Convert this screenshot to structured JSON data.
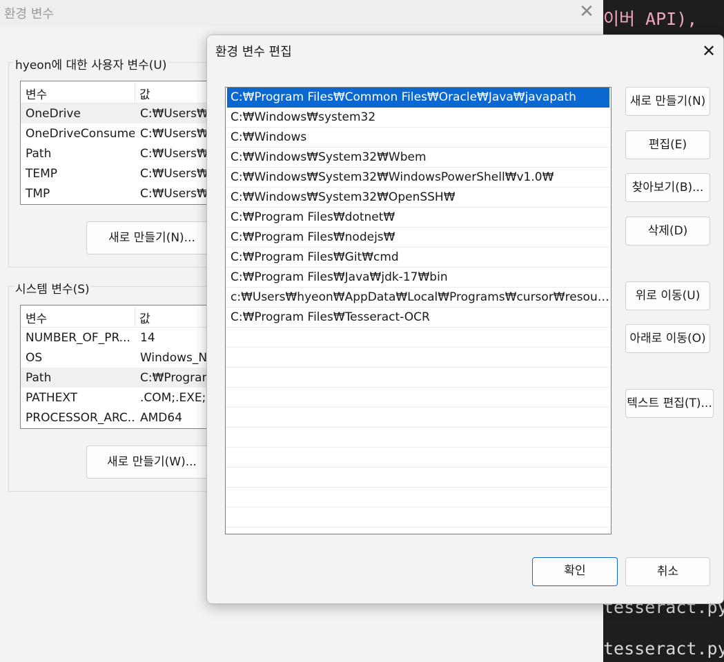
{
  "terminal": {
    "top_text": "이버 API),",
    "bottom_lines": [
      "tesseract.py",
      "tesseract.py"
    ]
  },
  "background_window": {
    "title": "환경 변수",
    "close_glyph": "✕",
    "user_group_label": "hyeon에 대한 사용자 변수(U)",
    "system_group_label": "시스템 변수(S)",
    "columns": [
      "변수",
      "값"
    ],
    "user_vars": [
      {
        "name": "OneDrive",
        "value": "C:₩Users₩h"
      },
      {
        "name": "OneDriveConsumer",
        "value": "C:₩Users₩h"
      },
      {
        "name": "Path",
        "value": "C:₩Users₩h"
      },
      {
        "name": "TEMP",
        "value": "C:₩Users₩h"
      },
      {
        "name": "TMP",
        "value": "C:₩Users₩h"
      }
    ],
    "system_vars": [
      {
        "name": "NUMBER_OF_PR...",
        "value": "14"
      },
      {
        "name": "OS",
        "value": "Windows_N"
      },
      {
        "name": "Path",
        "value": "C:₩Program"
      },
      {
        "name": "PATHEXT",
        "value": ".COM;.EXE;.B"
      },
      {
        "name": "PROCESSOR_ARC...",
        "value": "AMD64"
      }
    ],
    "user_new_button": "새로 만들기(N)...",
    "system_new_button": "새로 만들기(W)..."
  },
  "dialog": {
    "title": "환경 변수 편집",
    "close_glyph": "✕",
    "paths": [
      "C:₩Program Files₩Common Files₩Oracle₩Java₩javapath",
      "C:₩Windows₩system32",
      "C:₩Windows",
      "C:₩Windows₩System32₩Wbem",
      "C:₩Windows₩System32₩WindowsPowerShell₩v1.0₩",
      "C:₩Windows₩System32₩OpenSSH₩",
      "C:₩Program Files₩dotnet₩",
      "C:₩Program Files₩nodejs₩",
      "C:₩Program Files₩Git₩cmd",
      "C:₩Program Files₩Java₩jdk-17₩bin",
      "c:₩Users₩hyeon₩AppData₩Local₩Programs₩cursor₩resources...",
      "C:₩Program Files₩Tesseract-OCR"
    ],
    "buttons": {
      "new": "새로 만들기(N)",
      "edit": "편집(E)",
      "browse": "찾아보기(B)...",
      "delete": "삭제(D)",
      "move_up": "위로 이동(U)",
      "move_down": "아래로 이동(O)",
      "edit_text": "텍스트 편집(T)...",
      "ok": "확인",
      "cancel": "취소"
    }
  }
}
